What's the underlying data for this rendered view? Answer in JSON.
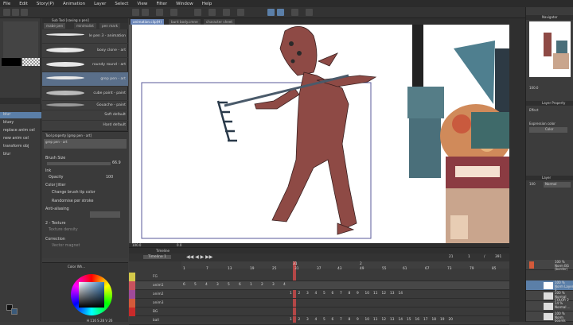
{
  "menu": [
    "File",
    "Edit",
    "Story(P)",
    "Animation",
    "Layer",
    "Select",
    "View",
    "Filter",
    "Window",
    "Help"
  ],
  "subtool": {
    "header": "Sub Tool [saving a pen]",
    "tabs": [
      "mabe pen",
      "minimalist",
      "pen mark"
    ],
    "brushes": [
      "le pen 3 - animation",
      "boxy clone - art",
      "roundy round - art",
      "grep pen - art",
      "cube paint - paint",
      "Gouache - paint",
      "Soft default",
      "Hard default"
    ]
  },
  "left_list": {
    "items": [
      "blur",
      "bluey",
      "replace anim cel",
      "new anim cel",
      "transform obj",
      "blur"
    ]
  },
  "tool_property": {
    "header": "Tool property [grep pen - art]",
    "current": "grep pen - art",
    "brush_size_label": "Brush Size",
    "brush_size": "66.9",
    "ink_label": "Ink",
    "opacity_label": "Opacity",
    "opacity": "100",
    "color_jitter_label": "Color Jitter",
    "change_tip": "Change brush tip color",
    "randomise": "Randomise per stroke",
    "antialias_label": "Anti-aliasing",
    "texture_label": "2 - Texture",
    "texture_density": "Texture density",
    "correction_label": "Correction",
    "vector_magnet": "Vector magnet"
  },
  "color_panel": {
    "header": "Color Wh...",
    "readout": "H 116  S 28  V 26"
  },
  "tabs": [
    "animation.clip(H)",
    "bunt body.cmne",
    "character sheet"
  ],
  "canvas": {
    "zoom": "100.0",
    "angle": "0.0"
  },
  "timeline": {
    "header": "Timeline",
    "name": "Timeline 1",
    "frame_numbers": [
      "1",
      "7",
      "13",
      "19",
      "25",
      "31",
      "37",
      "43",
      "49",
      "55",
      "61",
      "67",
      "73",
      "79",
      "85"
    ],
    "top_right": [
      "21",
      "1",
      "/",
      "391"
    ],
    "tracks": [
      "FG",
      "anim1",
      "anim2",
      "anim3",
      "BG",
      "ball"
    ],
    "seq1": [
      "6",
      "5",
      "4",
      "3",
      "5",
      "6",
      "1",
      "2",
      "3",
      "4"
    ],
    "seq2": [
      "1",
      "2",
      "3",
      "4",
      "5",
      "6",
      "7",
      "8",
      "9",
      "10",
      "11",
      "12",
      "13",
      "14"
    ],
    "seq3": [
      "1",
      "2",
      "3",
      "4",
      "5",
      "6",
      "7",
      "8",
      "9",
      "10",
      "11",
      "12",
      "13",
      "14",
      "15",
      "16",
      "17",
      "18",
      "19",
      "20"
    ],
    "marker": "31",
    "marker2": "2"
  },
  "navigator": {
    "header": "Navigator",
    "zoom": "100.0"
  },
  "layer_property": {
    "header": "Layer Property",
    "effect": "Effect",
    "expression_color": "Expression color",
    "color": "Color"
  },
  "layers": {
    "header": "Layer",
    "blend": "Normal",
    "opacity": "100",
    "items": [
      "100 % Norm BG (border)",
      "100 % Norm Layer 1",
      "100 % Normal COLOR 2",
      "14 % Normal ...",
      "100 % Norm boards"
    ]
  },
  "colors": {
    "accent": "#5b7fa8",
    "character": "#8e4a45",
    "canvas": "#ffffff"
  }
}
